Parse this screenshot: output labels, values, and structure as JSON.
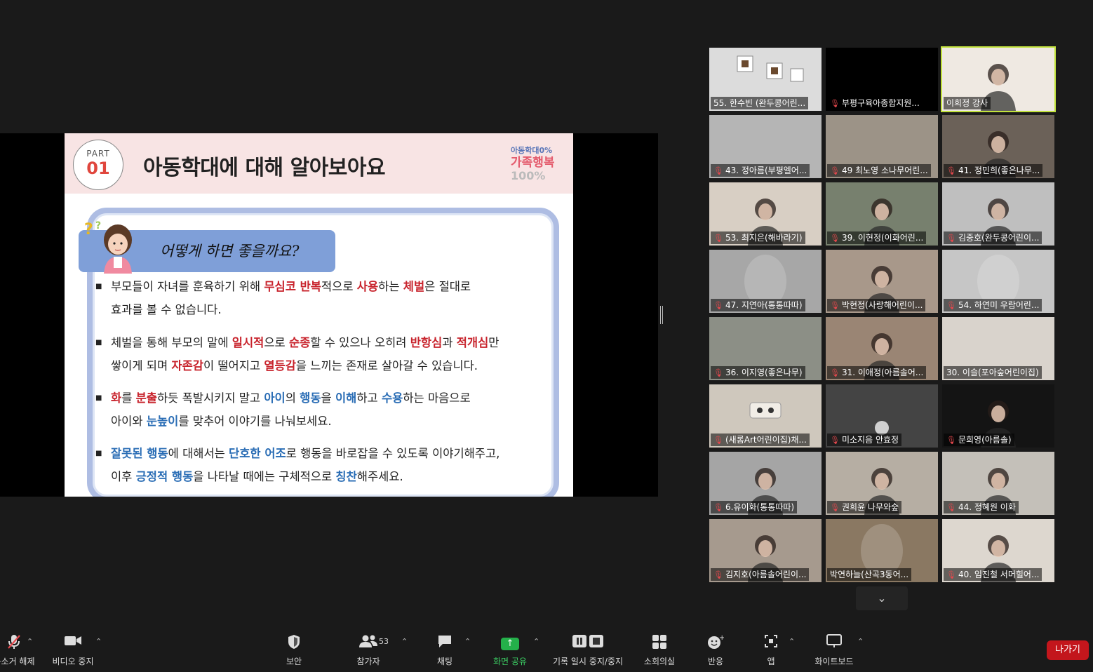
{
  "slide": {
    "part_label": "PART",
    "part_number": "01",
    "title": "아동학대에 대해 알아보아요",
    "brand_line1": "아동학대0%",
    "brand_line2": "가족행복",
    "brand_line3": "100%",
    "question": "어떻게 하면 좋을까요?",
    "bullet1": [
      [
        [
          "부모들이 자녀를 훈육하기 위해  ",
          ""
        ],
        [
          "무심코 반복",
          "red"
        ],
        [
          "적으로 ",
          ""
        ],
        [
          "사용",
          "red"
        ],
        [
          "하는 ",
          ""
        ],
        [
          "체벌",
          "red"
        ],
        [
          "은 절대로",
          ""
        ]
      ],
      [
        [
          "효과를 볼 수 없습니다.",
          ""
        ]
      ]
    ],
    "bullet2": [
      [
        [
          "체벌을 통해 부모의 말에 ",
          ""
        ],
        [
          "일시적",
          "red"
        ],
        [
          "으로 ",
          ""
        ],
        [
          "순종",
          "red"
        ],
        [
          "할 수 있으나 오히려 ",
          ""
        ],
        [
          "반항심",
          "red"
        ],
        [
          "과 ",
          ""
        ],
        [
          "적개심",
          "red"
        ],
        [
          "만",
          ""
        ]
      ],
      [
        [
          "쌓이게 되며 ",
          ""
        ],
        [
          "자존감",
          "red"
        ],
        [
          "이 떨어지고 ",
          ""
        ],
        [
          "열등감",
          "red"
        ],
        [
          "을 느끼는 존재로 살아갈 수 있습니다.",
          ""
        ]
      ]
    ],
    "bullet3": [
      [
        [
          "화",
          "red"
        ],
        [
          "를 ",
          ""
        ],
        [
          "분출",
          "red"
        ],
        [
          "하듯 폭발시키지 말고 ",
          ""
        ],
        [
          "아이",
          "blue"
        ],
        [
          "의 ",
          ""
        ],
        [
          "행동",
          "blue"
        ],
        [
          "을 ",
          ""
        ],
        [
          "이해",
          "blue"
        ],
        [
          "하고 ",
          ""
        ],
        [
          "수용",
          "blue"
        ],
        [
          "하는 마음으로",
          ""
        ]
      ],
      [
        [
          "아이와 ",
          ""
        ],
        [
          "눈높이",
          "blue"
        ],
        [
          "를 맞추어 이야기를 나눠보세요.",
          ""
        ]
      ]
    ],
    "bullet4": [
      [
        [
          "잘못된 행동",
          "blue"
        ],
        [
          "에 대해서는 ",
          ""
        ],
        [
          "단호한 어조",
          "blue"
        ],
        [
          "로 행동을 바로잡을 수 있도록 이야기해주고,",
          ""
        ]
      ],
      [
        [
          "이후 ",
          ""
        ],
        [
          "긍정적 행동",
          "blue"
        ],
        [
          "을 나타날 때에는 구체적으로 ",
          ""
        ],
        [
          "칭찬",
          "blue"
        ],
        [
          "해주세요.",
          ""
        ]
      ]
    ]
  },
  "participants": [
    {
      "name": "55. 한수빈 (완두콩어린...",
      "muted": false,
      "bg": "#dcdcdc",
      "icon": "room-wall-icon"
    },
    {
      "name": "부평구육아종합지원...",
      "muted": true,
      "bg": "#000000",
      "icon": "camera-off-icon"
    },
    {
      "name": "이희정 강사",
      "muted": false,
      "bg": "#efe9e2",
      "icon": "person-icon",
      "active": true
    },
    {
      "name": "43. 정아름(부평엘어...",
      "muted": true,
      "bg": "#b5b5b5",
      "icon": "ceiling-icon"
    },
    {
      "name": "49 최노영 소나무어린...",
      "muted": true,
      "bg": "#9c9387",
      "icon": "room-icon"
    },
    {
      "name": "41. 정민희(좋은나무...",
      "muted": true,
      "bg": "#6b6158",
      "icon": "person-icon"
    },
    {
      "name": "53. 최지은(해바라기)",
      "muted": true,
      "bg": "#d8cfc4",
      "icon": "person-icon"
    },
    {
      "name": "39. 이현정(이화어린...",
      "muted": true,
      "bg": "#77806e",
      "icon": "person-icon"
    },
    {
      "name": "김중호(완두콩어린이...",
      "muted": true,
      "bg": "#bfbfbf",
      "icon": "person-icon"
    },
    {
      "name": "47. 지연아(통통따따)",
      "muted": true,
      "bg": "#a7a7a7",
      "icon": "blur-icon"
    },
    {
      "name": "박현정(사랑해어린이...",
      "muted": true,
      "bg": "#a8988a",
      "icon": "person-icon"
    },
    {
      "name": "54. 하연미 우람어린...",
      "muted": true,
      "bg": "#c6c6c6",
      "icon": "blur-icon"
    },
    {
      "name": "36. 이지영(좋은나무)",
      "muted": true,
      "bg": "#8c8f86",
      "icon": "room-icon"
    },
    {
      "name": "31. 이애정(아름솔어...",
      "muted": true,
      "bg": "#9a8574",
      "icon": "person-icon"
    },
    {
      "name": "30. 이슬(포아숲어린이집)",
      "muted": false,
      "bg": "#d9d3cc",
      "icon": "ceiling-icon"
    },
    {
      "name": "(새롬Art어린이집)채...",
      "muted": true,
      "bg": "#cfc8bd",
      "icon": "switch-icon"
    },
    {
      "name": "미소지음 안효정",
      "muted": true,
      "bg": "#444444",
      "icon": "light-icon"
    },
    {
      "name": "문희영(아름솔)",
      "muted": true,
      "bg": "#141414",
      "icon": "person-icon"
    },
    {
      "name": "6.유이화(통통따따)",
      "muted": true,
      "bg": "#a5a5a5",
      "icon": "person-icon"
    },
    {
      "name": "권희윤 나무와숲",
      "muted": true,
      "bg": "#b6aea3",
      "icon": "person-icon"
    },
    {
      "name": "44. 정혜원 이화",
      "muted": true,
      "bg": "#c4c0b9",
      "icon": "person-icon"
    },
    {
      "name": "김지호(아름솔어린이...",
      "muted": true,
      "bg": "#a69a8e",
      "icon": "person-icon"
    },
    {
      "name": "박연하늘(산곡3동어...",
      "muted": false,
      "bg": "#8a7862",
      "icon": "blur-icon"
    },
    {
      "name": "40. 임진철 서머힐어...",
      "muted": true,
      "bg": "#ddd7cf",
      "icon": "person-icon"
    }
  ],
  "toolbar": {
    "mute_label": "음소거 해제",
    "video_label": "비디오 중지",
    "security_label": "보안",
    "participants_label": "참가자",
    "participants_count": "53",
    "chat_label": "채팅",
    "share_label": "화면 공유",
    "record_label": "기록 일시 중지/중지",
    "breakout_label": "소회의실",
    "reactions_label": "반응",
    "apps_label": "앱",
    "whiteboard_label": "화이트보드",
    "leave_label": "나가기"
  },
  "colors": {
    "share_green": "#24b04a",
    "leave_red": "#c3161c",
    "active_speaker": "#c3e33d",
    "mute_red": "#e5484d"
  }
}
